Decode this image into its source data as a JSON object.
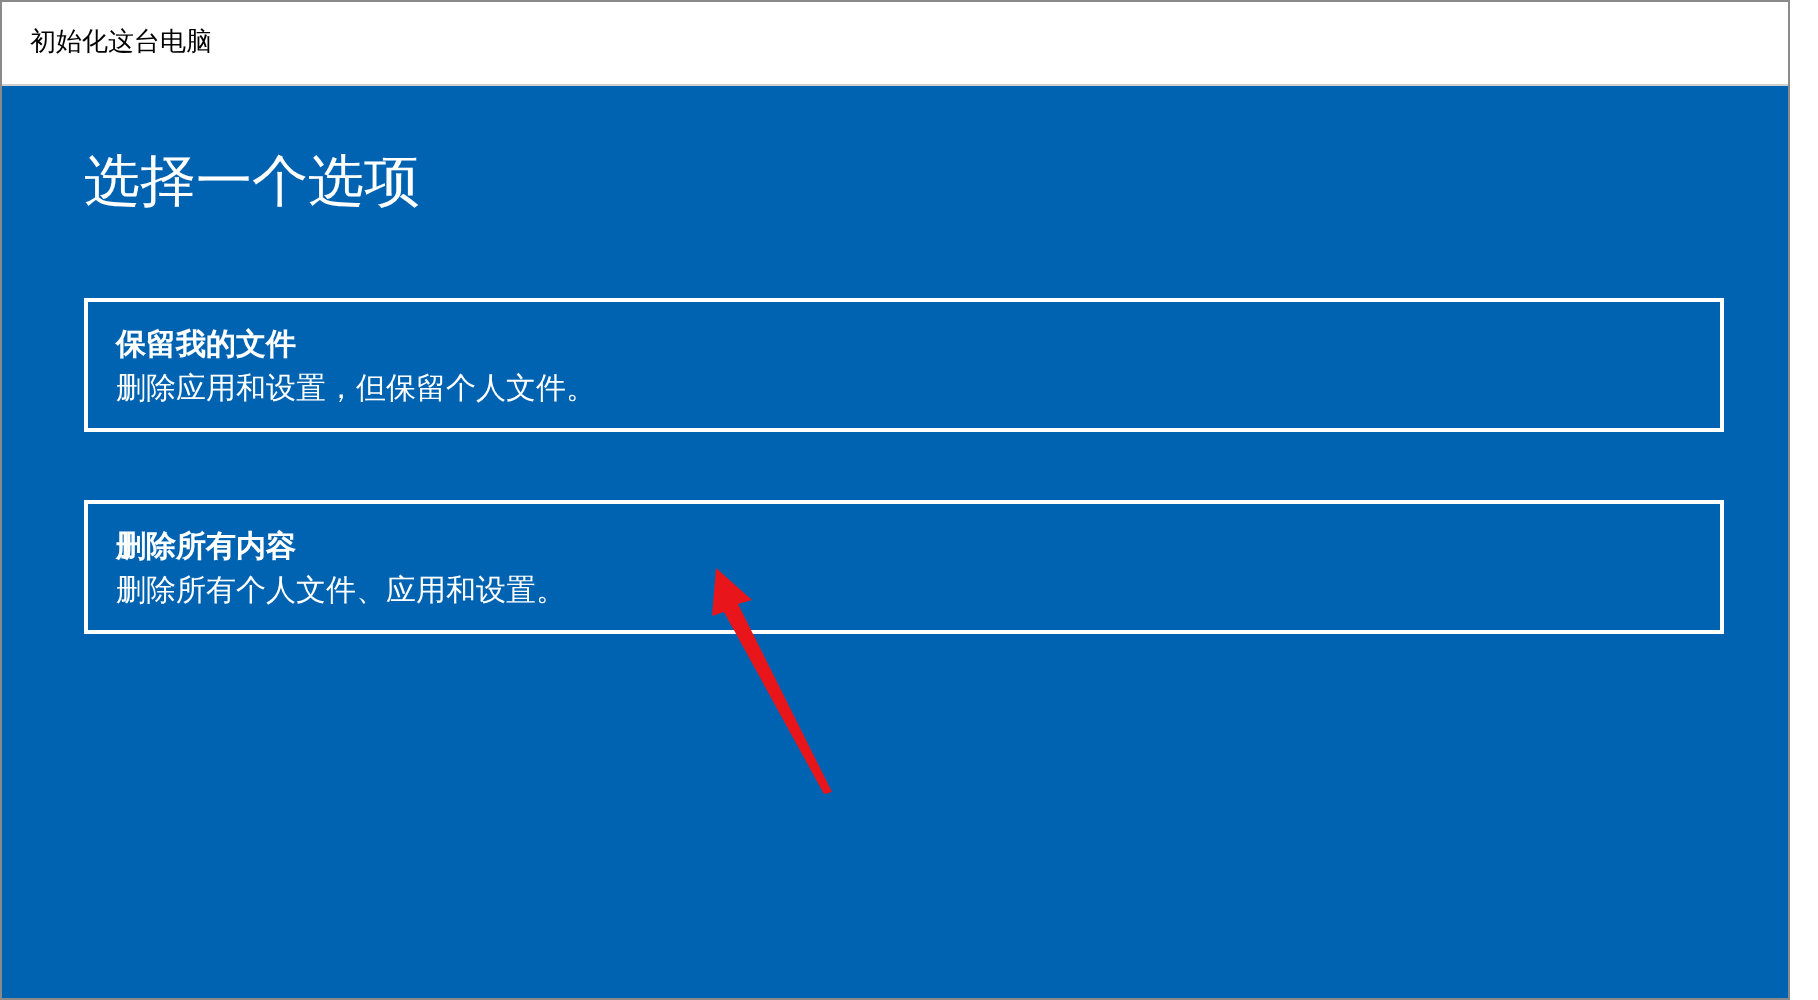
{
  "window": {
    "title": "初始化这台电脑"
  },
  "heading": "选择一个选项",
  "options": [
    {
      "title": "保留我的文件",
      "description": "删除应用和设置，但保留个人文件。"
    },
    {
      "title": "删除所有内容",
      "description": "删除所有个人文件、应用和设置。"
    }
  ]
}
